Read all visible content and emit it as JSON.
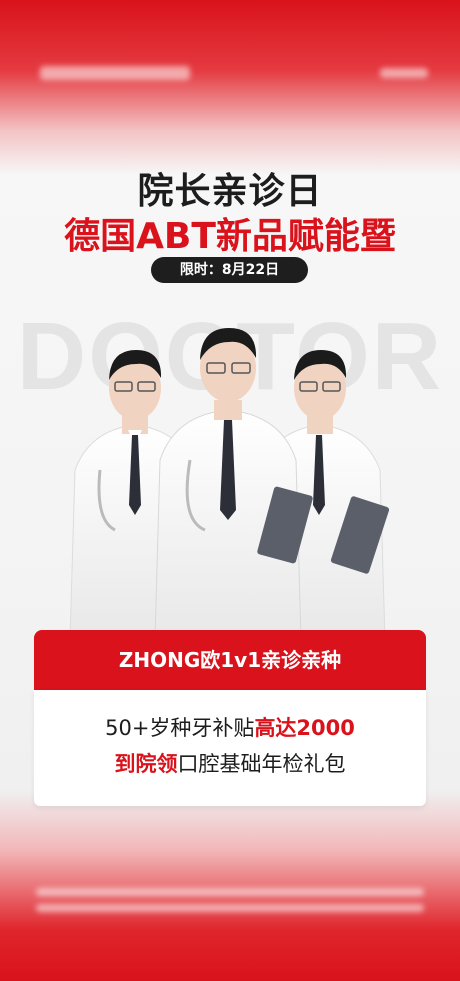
{
  "header": {
    "title_line1": "院长亲诊日",
    "title_line2": "德国ABT新品赋能暨",
    "date_label": "限时：8月22日"
  },
  "watermark": {
    "text": "DOCTOR"
  },
  "offer": {
    "banner": "ZHONG欧1v1亲诊亲种",
    "line1_prefix": "50+岁种牙补贴",
    "line1_highlight": "高达2000",
    "line2_highlight": "到院领",
    "line2_suffix": "口腔基础年检礼包"
  },
  "colors": {
    "brand_red": "#d9121b",
    "text_dark": "#1d1d1d",
    "pill_bg": "#1e1e1e"
  }
}
